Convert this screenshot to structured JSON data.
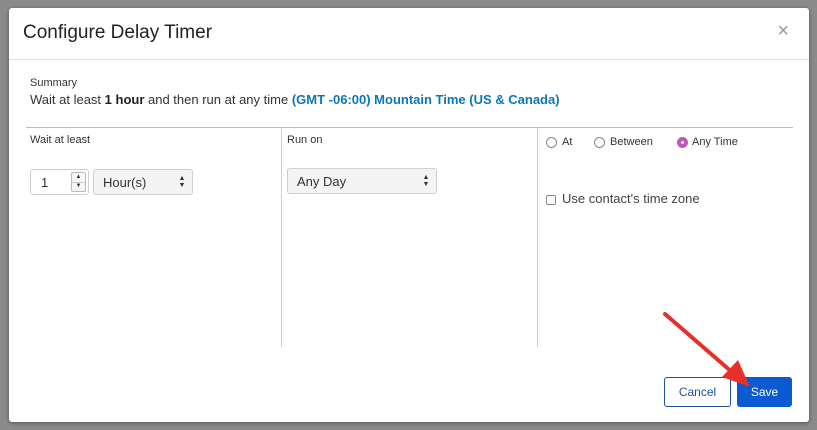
{
  "modal": {
    "title": "Configure Delay Timer",
    "close_symbol": "×"
  },
  "summary": {
    "label": "Summary",
    "prefix": "Wait at least ",
    "duration": "1 hour",
    "middle": " and then run at any time ",
    "timezone": "(GMT -06:00) Mountain Time (US & Canada)"
  },
  "wait": {
    "label": "Wait at least",
    "amount": "1",
    "unit": "Hour(s)"
  },
  "run_on": {
    "label": "Run on",
    "value": "Any Day"
  },
  "time_options": {
    "radios": [
      {
        "label": "At",
        "selected": false
      },
      {
        "label": "Between",
        "selected": false
      },
      {
        "label": "Any Time",
        "selected": true
      }
    ],
    "timezone_checkbox_label": "Use contact's time zone",
    "timezone_checked": false
  },
  "footer": {
    "cancel_label": "Cancel",
    "save_label": "Save"
  },
  "colors": {
    "primary": "#0b5ad1",
    "link": "#0b77b8",
    "radio_selected": "#c058b8",
    "annotation_arrow": "#e8302a"
  }
}
